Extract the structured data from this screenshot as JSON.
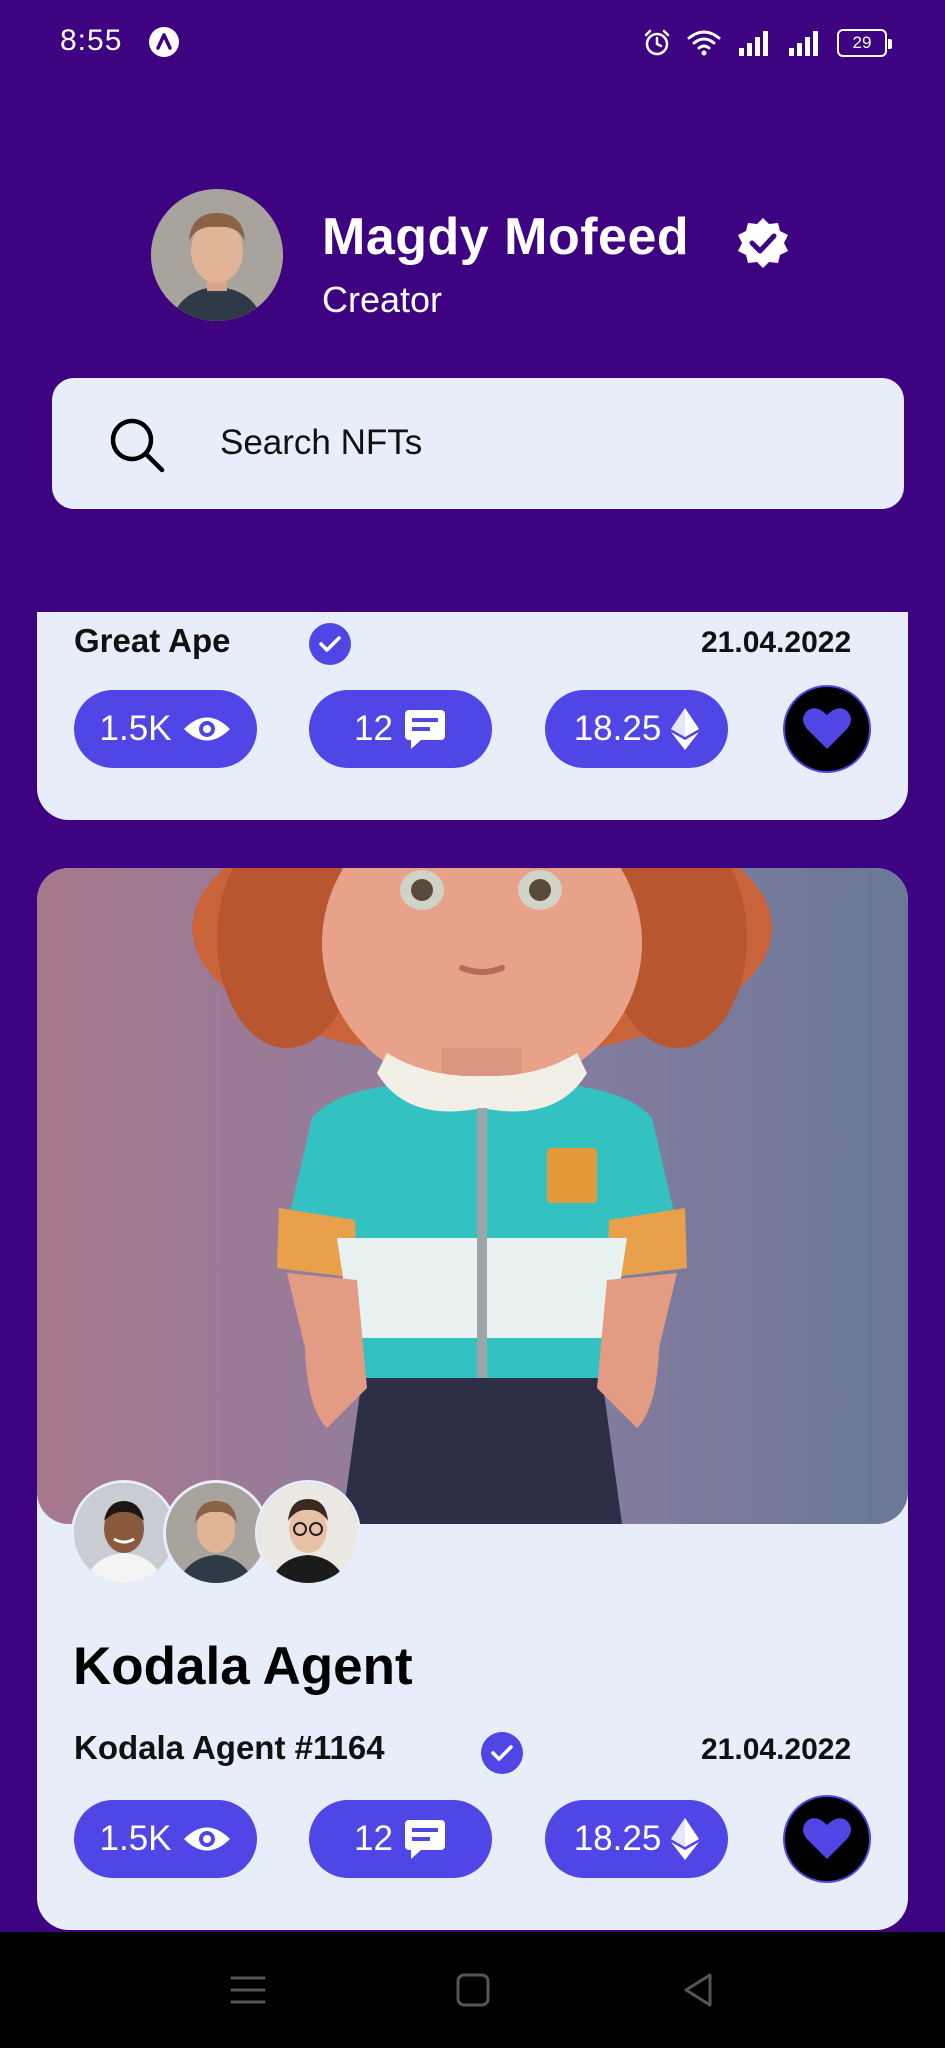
{
  "status_bar": {
    "time": "8:55",
    "battery": "29",
    "icons": [
      "app-badge-icon",
      "alarm-icon",
      "wifi-icon",
      "signal-icon",
      "signal-icon",
      "battery-icon"
    ]
  },
  "profile": {
    "name": "Magdy Mofeed",
    "role": "Creator",
    "verified_icon": "verified-badge-icon"
  },
  "search": {
    "placeholder": "Search NFTs",
    "icon": "search-icon"
  },
  "cards": [
    {
      "subtitle": "Great Ape",
      "date": "21.04.2022",
      "views": "1.5K",
      "comments": "12",
      "price": "18.25"
    },
    {
      "title": "Kodala Agent",
      "subtitle": "Kodala Agent #1164",
      "date": "21.04.2022",
      "views": "1.5K",
      "comments": "12",
      "price": "18.25"
    }
  ],
  "colors": {
    "background": "#3d0380",
    "card": "#e7eefa",
    "accent": "#5046e5",
    "heart_bg": "#000000"
  },
  "nav": {
    "icons": [
      "menu-icon",
      "home-square-icon",
      "back-triangle-icon"
    ]
  }
}
